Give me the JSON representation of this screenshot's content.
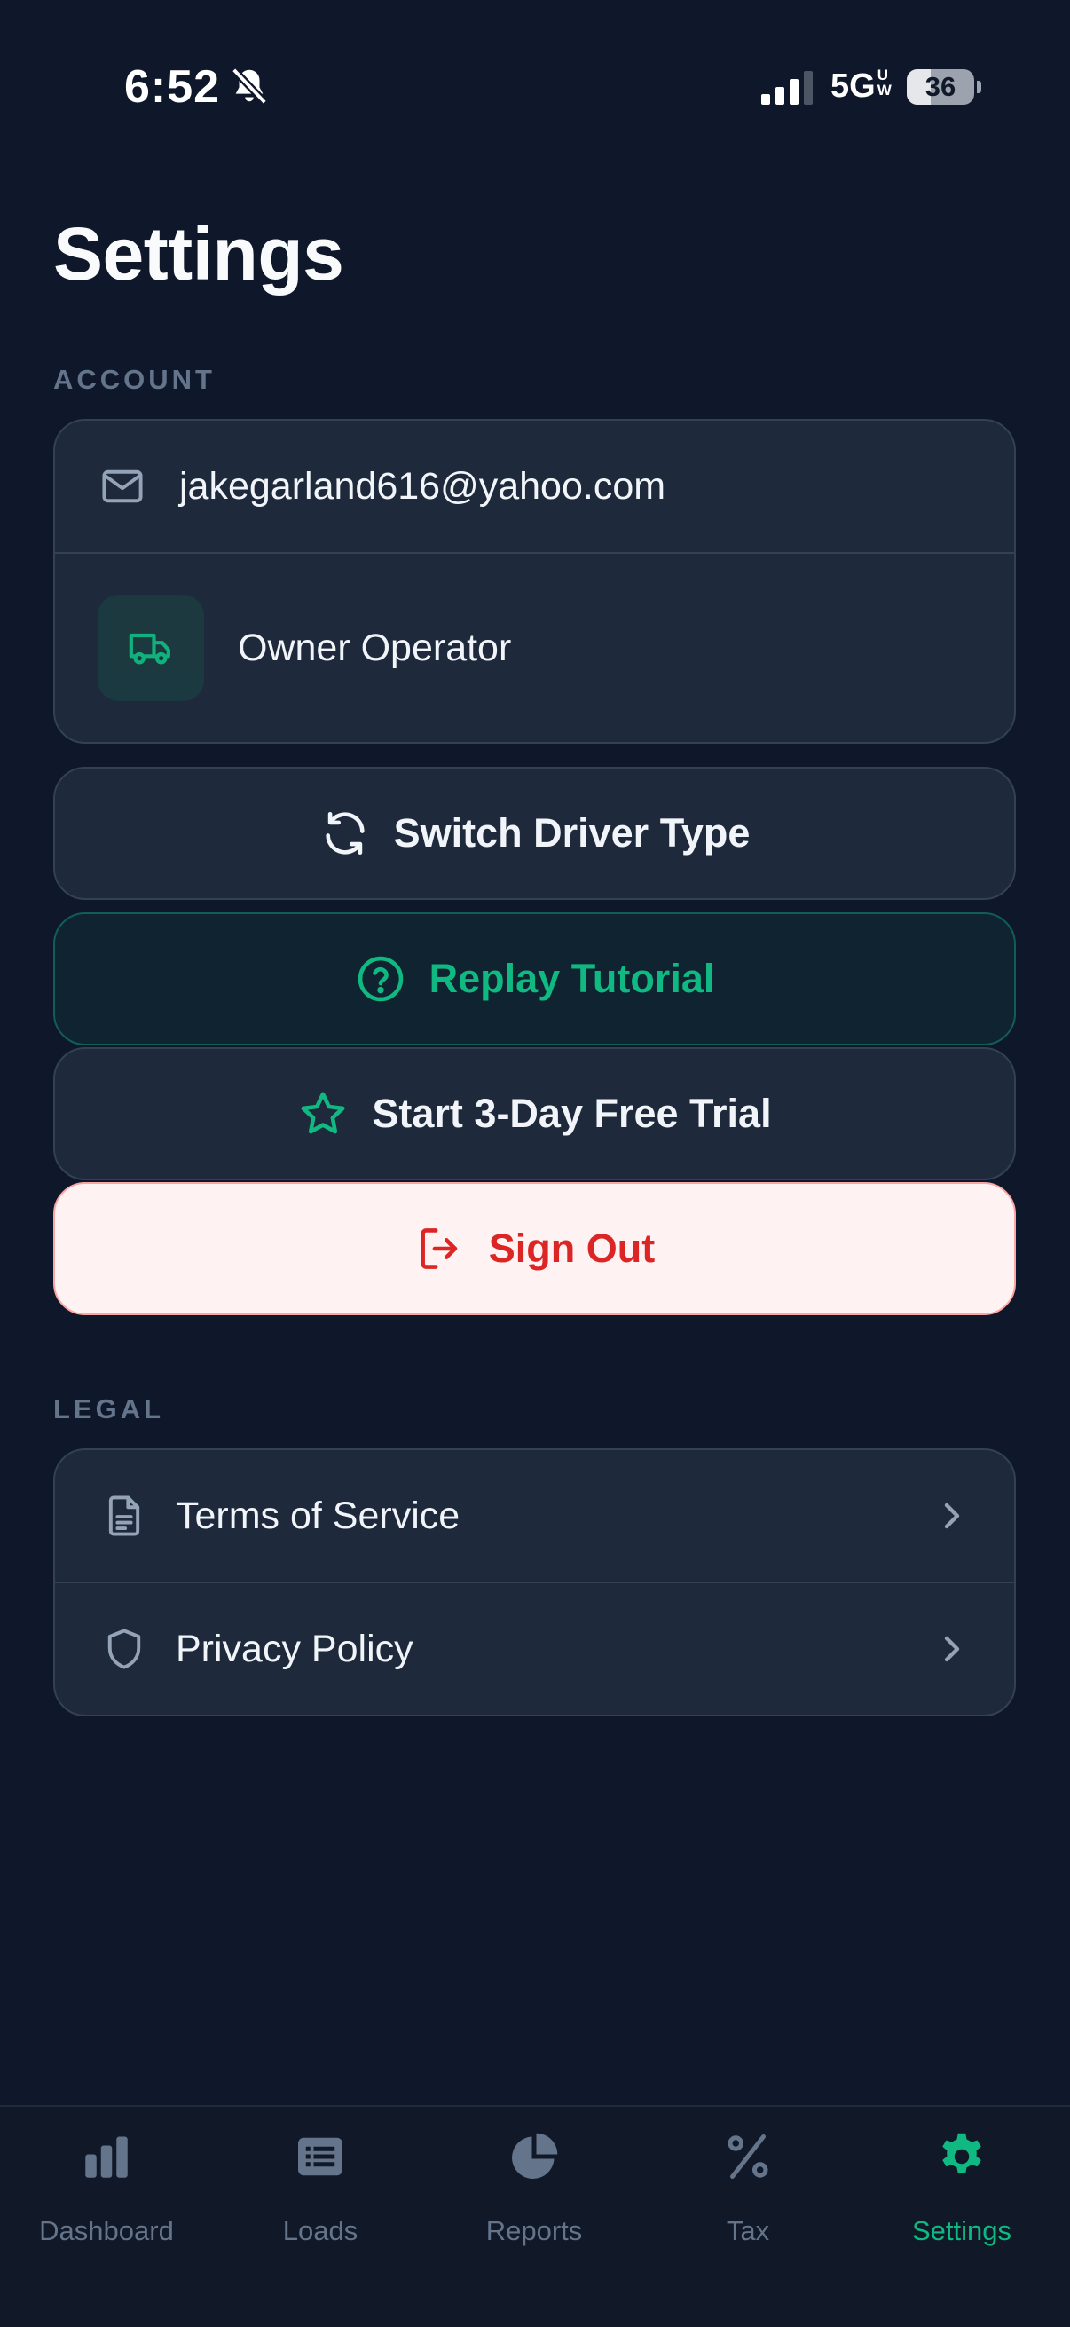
{
  "status_bar": {
    "time": "6:52",
    "network": "5G",
    "network_sup": "UW",
    "battery_level": 36,
    "battery_text": "36"
  },
  "page": {
    "title": "Settings"
  },
  "account": {
    "section_label": "ACCOUNT",
    "email": "jakegarland616@yahoo.com",
    "driver_type": "Owner Operator"
  },
  "actions": {
    "switch_driver_type": "Switch Driver Type",
    "replay_tutorial": "Replay Tutorial",
    "free_trial": "Start 3-Day Free Trial",
    "sign_out": "Sign Out"
  },
  "legal": {
    "section_label": "LEGAL",
    "items": [
      {
        "label": "Terms of Service",
        "icon": "document-icon"
      },
      {
        "label": "Privacy Policy",
        "icon": "shield-icon"
      }
    ]
  },
  "tab_bar": {
    "active": "Settings",
    "tabs": [
      {
        "label": "Dashboard",
        "icon": "bar-chart-icon"
      },
      {
        "label": "Loads",
        "icon": "list-icon"
      },
      {
        "label": "Reports",
        "icon": "pie-chart-icon"
      },
      {
        "label": "Tax",
        "icon": "percent-icon"
      },
      {
        "label": "Settings",
        "icon": "gear-icon"
      }
    ]
  },
  "colors": {
    "background": "#0f172a",
    "card": "#1e293b",
    "accent": "#10b981",
    "danger": "#dc2626",
    "danger_bg": "#fef2f2"
  }
}
